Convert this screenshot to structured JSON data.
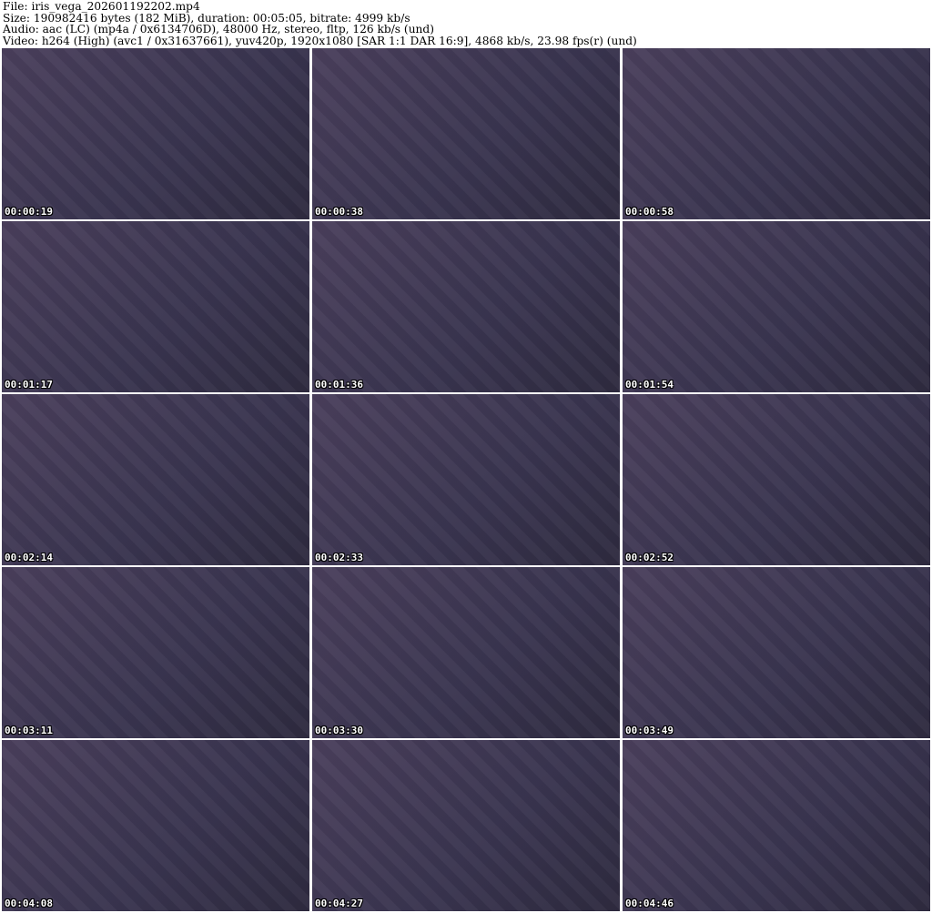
{
  "header": {
    "file": "File: iris_vega_202601192202.mp4",
    "size": "Size: 190982416 bytes (182 MiB), duration: 00:05:05, bitrate: 4999 kb/s",
    "audio": "Audio: aac (LC) (mp4a / 0x6134706D), 48000 Hz, stereo, fltp, 126 kb/s (und)",
    "video": "Video: h264 (High) (avc1 / 0x31637661), yuv420p, 1920x1080 [SAR 1:1 DAR 16:9], 4868 kb/s, 23.98 fps(r) (und)"
  },
  "thumbnails": [
    {
      "time": "00:00:19"
    },
    {
      "time": "00:00:38"
    },
    {
      "time": "00:00:58"
    },
    {
      "time": "00:01:17"
    },
    {
      "time": "00:01:36"
    },
    {
      "time": "00:01:54"
    },
    {
      "time": "00:02:14"
    },
    {
      "time": "00:02:33"
    },
    {
      "time": "00:02:52"
    },
    {
      "time": "00:03:11"
    },
    {
      "time": "00:03:30"
    },
    {
      "time": "00:03:49"
    },
    {
      "time": "00:04:08"
    },
    {
      "time": "00:04:27"
    },
    {
      "time": "00:04:46"
    }
  ]
}
